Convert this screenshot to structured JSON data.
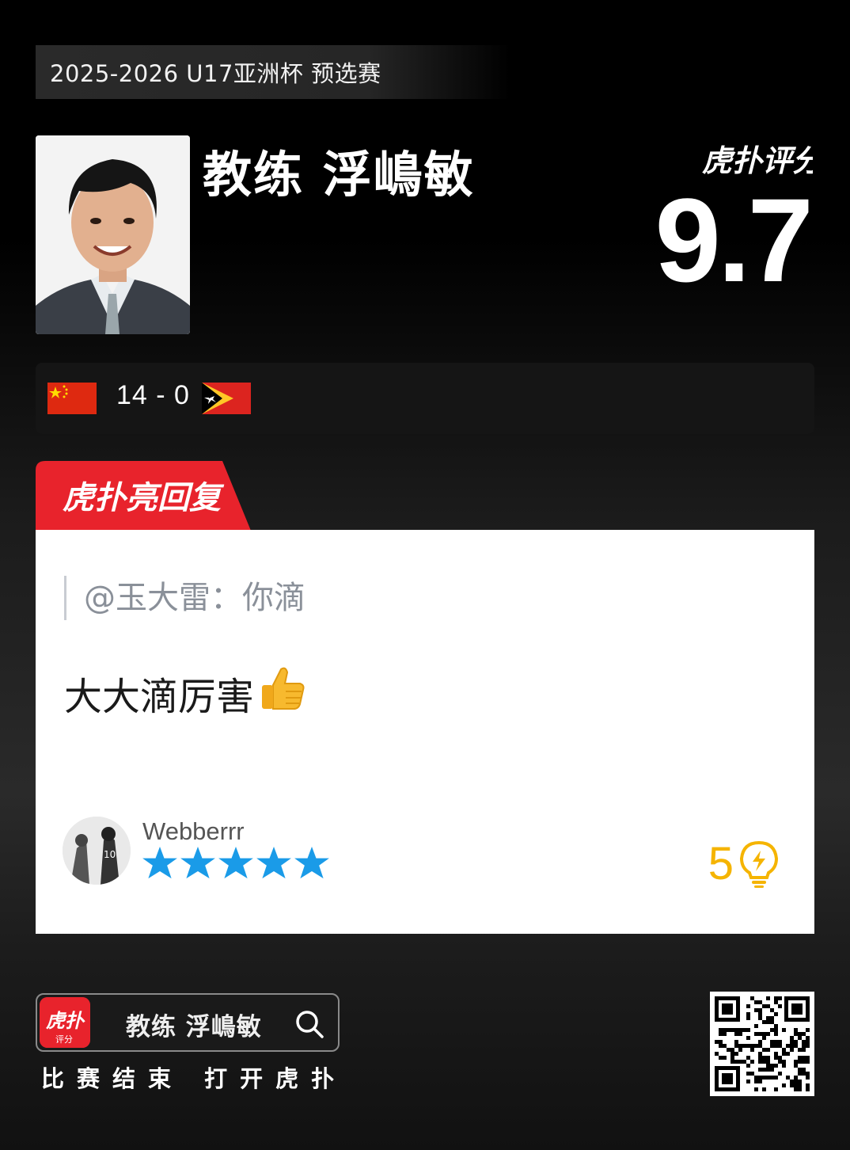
{
  "competition": "2025-2026 U17亚洲杯 预选赛",
  "coach": {
    "name": "教练 浮嶋敏"
  },
  "rating": {
    "brand": "虎扑评分",
    "score": "9.7"
  },
  "match": {
    "score": "14 - 0",
    "home_flag": "china-flag",
    "away_flag": "timor-leste-flag"
  },
  "reply_section": {
    "label": "虎扑亮回复"
  },
  "reply": {
    "quote": "@玉大雷：你滴",
    "text": "大大滴厉害",
    "emoji": "thumbs-up-icon",
    "username": "Webberrr",
    "stars": 5,
    "likes": "5"
  },
  "footer": {
    "search_text": "教练 浮嶋敏",
    "app_icon_text": "虎扑",
    "app_icon_sub": "评分",
    "caption": "比赛结束 打开虎扑"
  },
  "colors": {
    "accent_red": "#e8232c",
    "like_yellow": "#f5b400",
    "star_blue": "#1a9be8"
  }
}
